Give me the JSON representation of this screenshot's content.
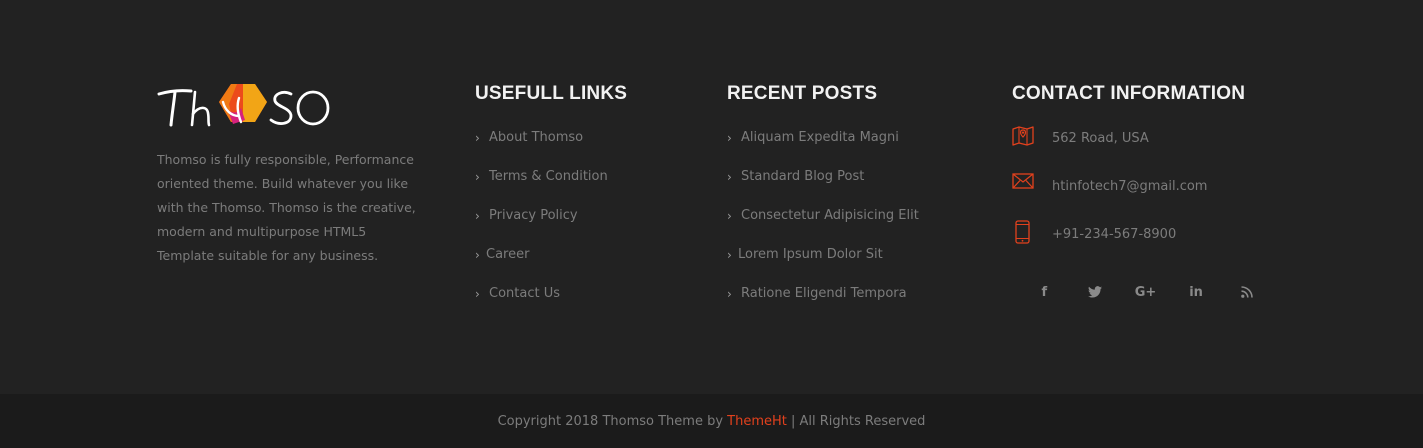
{
  "brand": {
    "logo_text": "Thomso",
    "about": "Thomso is fully responsible, Performance oriented theme. Build whatever you like with the Thomso. Thomso is the creative, modern and multipurpose HTML5 Template suitable for any business."
  },
  "links": {
    "title": "USEFULL LINKS",
    "items": [
      {
        "label": "About Thomso"
      },
      {
        "label": "Terms & Condition"
      },
      {
        "label": "Privacy Policy"
      },
      {
        "label": "Career"
      },
      {
        "label": "Contact Us"
      }
    ]
  },
  "posts": {
    "title": "RECENT POSTS",
    "items": [
      {
        "label": "Aliquam Expedita Magni"
      },
      {
        "label": "Standard Blog Post"
      },
      {
        "label": "Consectetur Adipisicing Elit"
      },
      {
        "label": "Lorem Ipsum Dolor Sit"
      },
      {
        "label": "Ratione Eligendi Tempora"
      }
    ]
  },
  "contact": {
    "title": "CONTACT INFORMATION",
    "address": "562 Road, USA",
    "email": "htinfotech7@gmail.com",
    "phone": "+91-234-567-8900"
  },
  "social": {
    "facebook": "f",
    "twitter": "twitter-icon",
    "google_plus": "G+",
    "linkedin": "in",
    "rss": "rss-icon"
  },
  "footer": {
    "copyright_prefix": "Copyright 2018 Thomso Theme by ",
    "brand_link": "ThemeHt",
    "copyright_suffix": " | All Rights Reserved"
  },
  "colors": {
    "background": "#222222",
    "bottom_bar": "#1b1b1b",
    "accent": "#e2411d",
    "heading": "#f2f2f2",
    "text": "#7c7c7c"
  }
}
